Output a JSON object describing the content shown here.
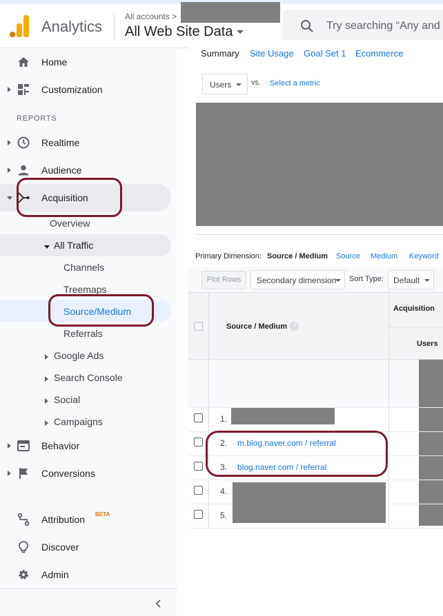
{
  "header": {
    "app_title": "Analytics",
    "account_crumb": "All accounts >",
    "view_name": "All Web Site Data",
    "search_placeholder": "Try searching “Any and"
  },
  "sidebar": {
    "home": "Home",
    "customization": "Customization",
    "reports_label": "REPORTS",
    "realtime": "Realtime",
    "audience": "Audience",
    "acquisition": "Acquisition",
    "overview": "Overview",
    "all_traffic": "All Traffic",
    "channels": "Channels",
    "treemaps": "Treemaps",
    "source_medium": "Source/Medium",
    "referrals": "Referrals",
    "google_ads": "Google Ads",
    "search_console": "Search Console",
    "social": "Social",
    "campaigns": "Campaigns",
    "behavior": "Behavior",
    "conversions": "Conversions",
    "attribution": "Attribution",
    "attribution_badge": "BETA",
    "discover": "Discover",
    "admin": "Admin"
  },
  "explorer_tabs": [
    "Summary",
    "Site Usage",
    "Goal Set 1",
    "Ecommerce"
  ],
  "metric_select": "Users",
  "vs_label": "vs.",
  "select_metric": "Select a metric",
  "primary_dimension": {
    "label": "Primary Dimension:",
    "active": "Source / Medium",
    "options": [
      "Source",
      "Medium",
      "Keyword"
    ]
  },
  "toolbar": {
    "plot_rows": "Plot Rows",
    "secondary_dimension": "Secondary dimension",
    "sort_type_label": "Sort Type:",
    "sort_type_value": "Default"
  },
  "table": {
    "col_source_medium": "Source / Medium",
    "help_glyph": "?",
    "group_acquisition": "Acquisition",
    "col_users": "Users",
    "rows": [
      {
        "num": "1.",
        "label": ""
      },
      {
        "num": "2.",
        "label": "m.blog.naver.com / referral"
      },
      {
        "num": "3.",
        "label": "blog.naver.com / referral"
      },
      {
        "num": "4.",
        "label": ""
      },
      {
        "num": "5.",
        "label": ""
      }
    ]
  },
  "colors": {
    "accent": "#1a73e8",
    "annotation": "#7b1a2b",
    "logo_orange": "#f9ab00",
    "logo_dark_orange": "#e37400",
    "redaction": "#808080"
  }
}
